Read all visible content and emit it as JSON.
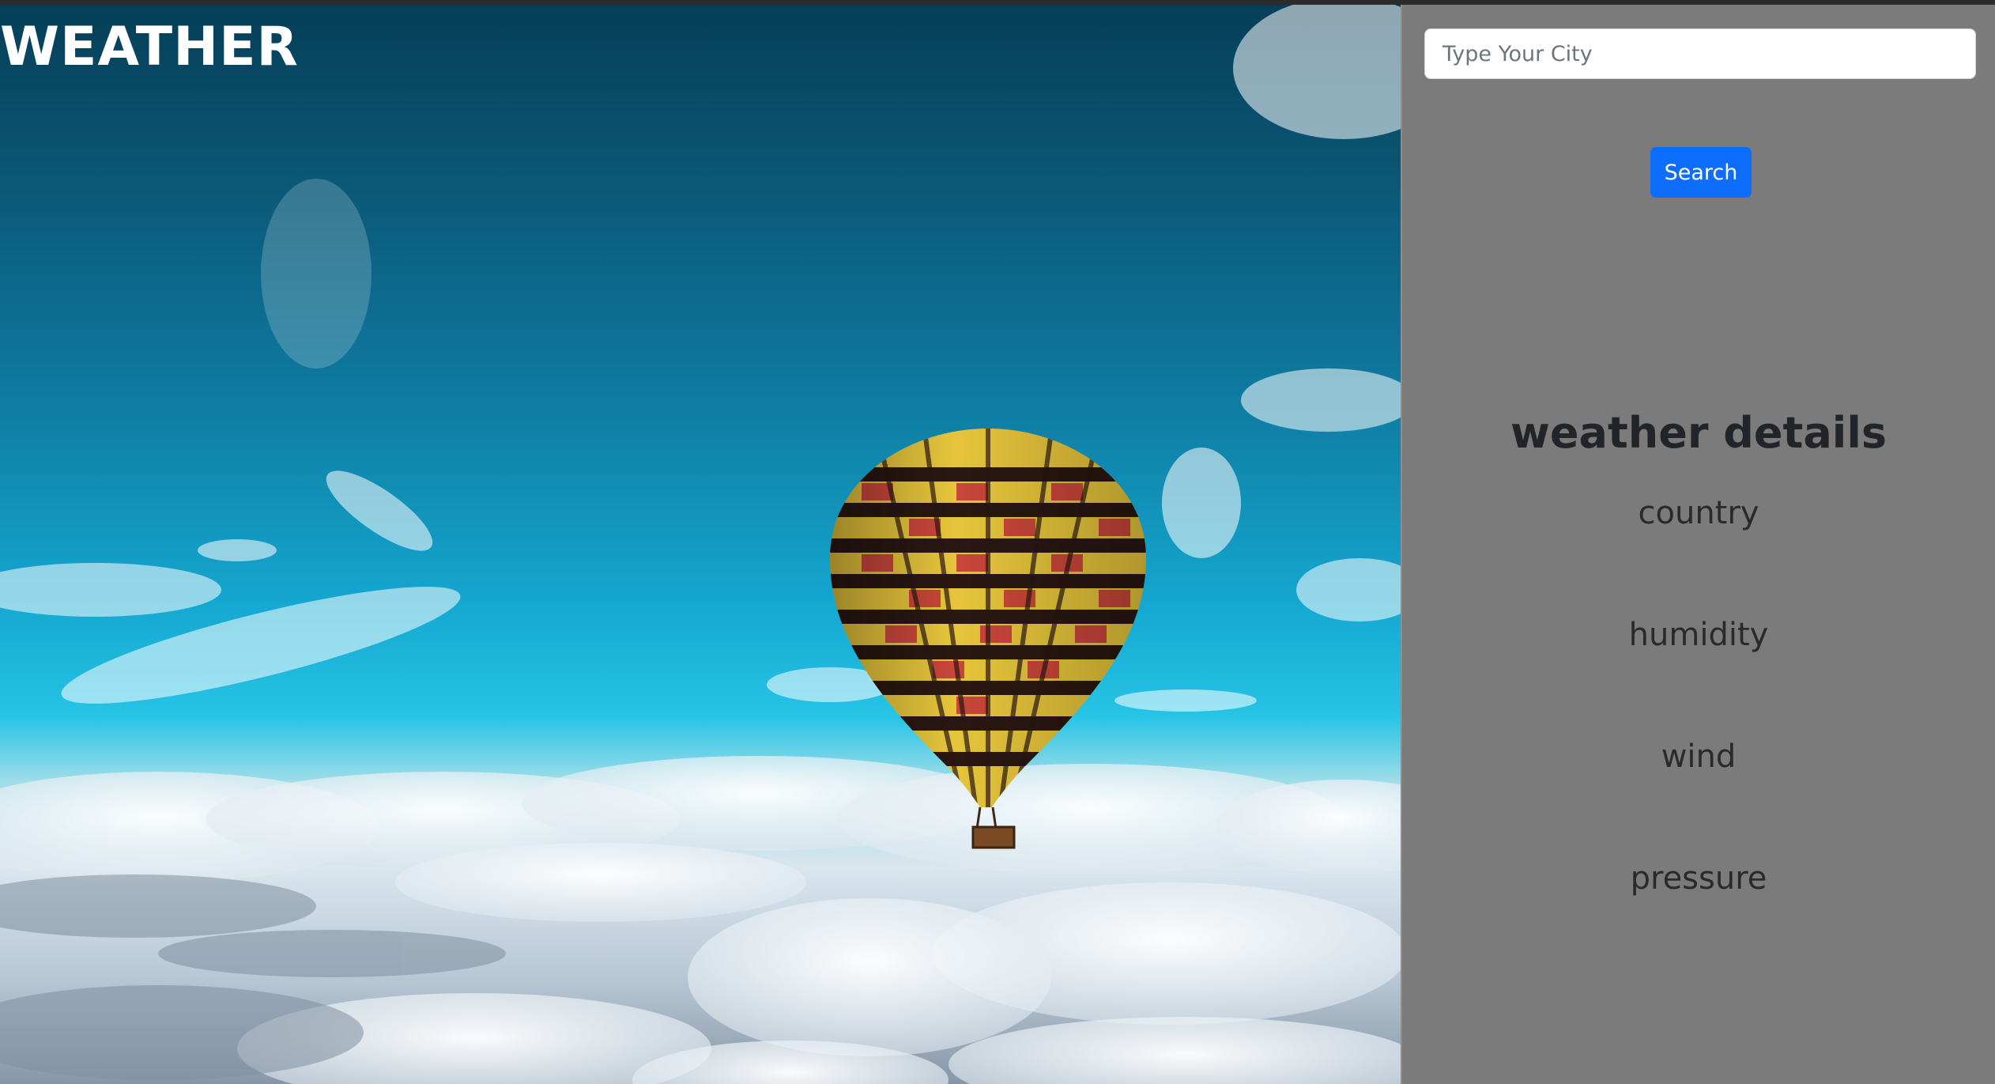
{
  "header": {
    "title": "WEATHER"
  },
  "search": {
    "placeholder": "Type Your City",
    "value": "",
    "button_label": "Search"
  },
  "details": {
    "title": "weather details",
    "items": [
      {
        "label": "country"
      },
      {
        "label": "humidity"
      },
      {
        "label": "wind"
      },
      {
        "label": "pressure"
      }
    ]
  },
  "colors": {
    "panel_bg": "#7b7b7b",
    "button_bg": "#0d6efd",
    "title_text": "#ffffff",
    "details_text": "#212529"
  }
}
